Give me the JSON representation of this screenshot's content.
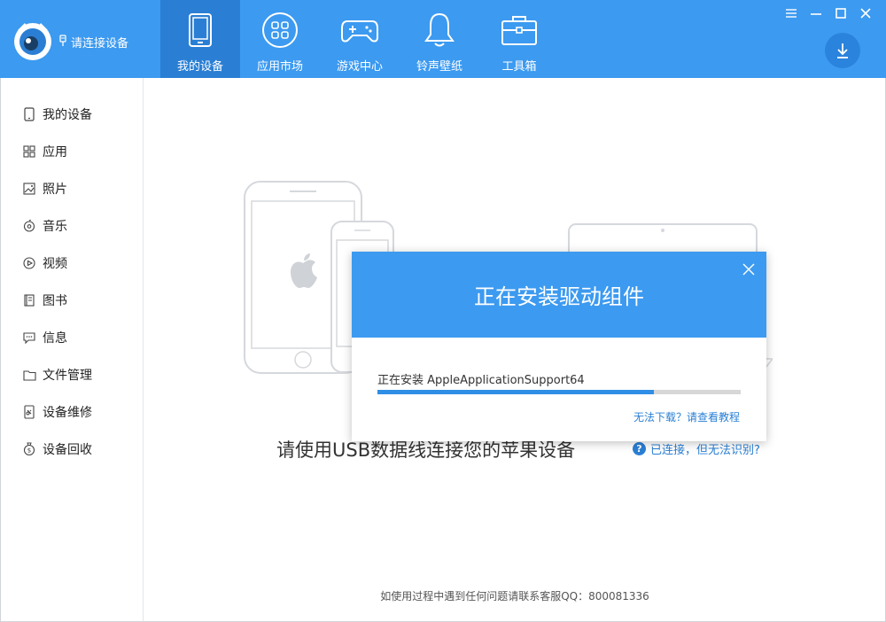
{
  "header": {
    "connect_label": "请连接设备",
    "nav": [
      {
        "label": "我的设备",
        "icon": "tablet-icon",
        "active": true
      },
      {
        "label": "应用市场",
        "icon": "app-grid-icon",
        "active": false
      },
      {
        "label": "游戏中心",
        "icon": "gamepad-icon",
        "active": false
      },
      {
        "label": "铃声壁纸",
        "icon": "bell-icon",
        "active": false
      },
      {
        "label": "工具箱",
        "icon": "toolbox-icon",
        "active": false
      }
    ]
  },
  "sidebar": {
    "items": [
      {
        "label": "我的设备",
        "icon": "phone-icon"
      },
      {
        "label": "应用",
        "icon": "grid-icon"
      },
      {
        "label": "照片",
        "icon": "photo-icon"
      },
      {
        "label": "音乐",
        "icon": "music-icon"
      },
      {
        "label": "视频",
        "icon": "video-icon"
      },
      {
        "label": "图书",
        "icon": "book-icon"
      },
      {
        "label": "信息",
        "icon": "message-icon"
      },
      {
        "label": "文件管理",
        "icon": "folder-icon"
      },
      {
        "label": "设备维修",
        "icon": "repair-icon"
      },
      {
        "label": "设备回收",
        "icon": "recycle-icon"
      }
    ]
  },
  "main": {
    "instruction": "请使用USB数据线连接您的苹果设备",
    "help_link": "已连接，但无法识别?",
    "footer": "如使用过程中遇到任何问题请联系客服QQ：800081336"
  },
  "dialog": {
    "title": "正在安装驱动组件",
    "status": "正在安装 AppleApplicationSupport64",
    "progress": 0.76,
    "link": "无法下载？请查看教程"
  },
  "colors": {
    "brand": "#3c9af0",
    "nav_active": "#2a7fd4",
    "progress_fill": "#2f8ee6"
  }
}
